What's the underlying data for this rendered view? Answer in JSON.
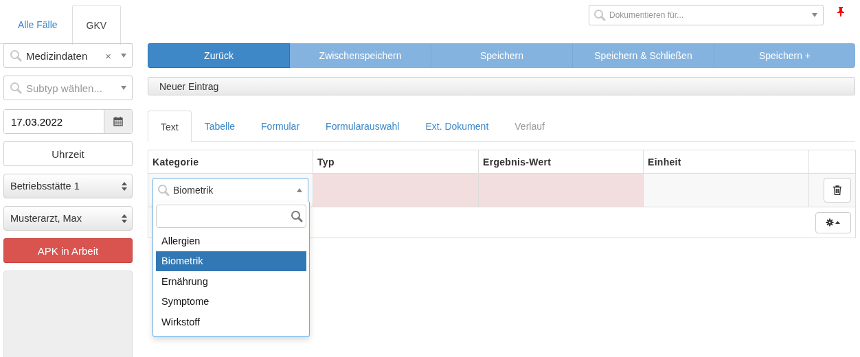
{
  "top_tabs": [
    {
      "label": "Alle Fälle",
      "selected": false
    },
    {
      "label": "GKV",
      "selected": true
    }
  ],
  "document_for": {
    "placeholder": "Dokumentieren für..."
  },
  "sidebar": {
    "type_select": {
      "value": "Medizindaten",
      "clear": "×"
    },
    "subtype_select": {
      "placeholder": "Subtyp wählen..."
    },
    "date": {
      "value": "17.03.2022"
    },
    "time_button": "Uhrzeit",
    "location_select": "Betriebsstätte 1",
    "doctor_select": "Musterarzt, Max",
    "status_button": "APK in Arbeit"
  },
  "actions": [
    {
      "label": "Zurück",
      "kind": "primary"
    },
    {
      "label": "Zwischenspeichern",
      "kind": "secondary"
    },
    {
      "label": "Speichern",
      "kind": "secondary"
    },
    {
      "label": "Speichern & Schließen",
      "kind": "secondary"
    },
    {
      "label": "Speichern +",
      "kind": "secondary"
    }
  ],
  "new_entry": "Neuer Eintrag",
  "tabs": [
    {
      "label": "Text",
      "selected": true,
      "disabled": false
    },
    {
      "label": "Tabelle",
      "selected": false,
      "disabled": false
    },
    {
      "label": "Formular",
      "selected": false,
      "disabled": false
    },
    {
      "label": "Formularauswahl",
      "selected": false,
      "disabled": false
    },
    {
      "label": "Ext. Dokument",
      "selected": false,
      "disabled": false
    },
    {
      "label": "Verlauf",
      "selected": false,
      "disabled": true
    }
  ],
  "table": {
    "columns": [
      "Kategorie",
      "Typ",
      "Ergebnis-Wert",
      "Einheit"
    ],
    "row": {
      "category": "Biometrik",
      "cells": [
        {
          "invalid": true
        },
        {
          "invalid": true
        },
        {
          "invalid": false
        }
      ]
    },
    "category_dropdown": {
      "options": [
        {
          "label": "Allergien",
          "selected": false
        },
        {
          "label": "Biometrik",
          "selected": true
        },
        {
          "label": "Ernährung",
          "selected": false
        },
        {
          "label": "Symptome",
          "selected": false
        },
        {
          "label": "Wirkstoff",
          "selected": false
        }
      ]
    }
  }
}
